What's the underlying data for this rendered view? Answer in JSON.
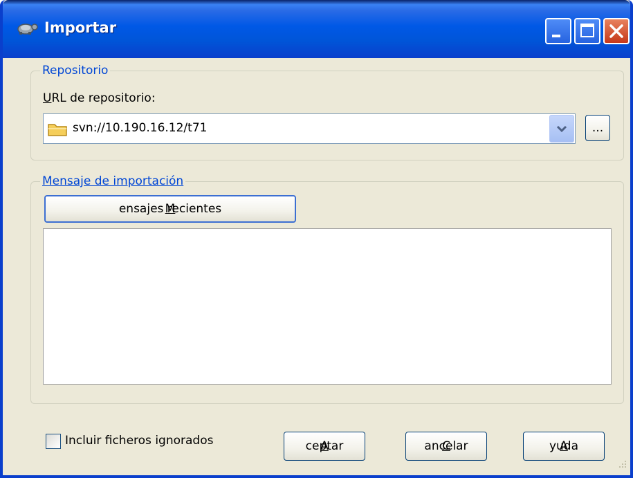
{
  "window": {
    "title": "Importar",
    "title_icon": "tortoise-icon",
    "controls": [
      "minimize-icon",
      "maximize-icon",
      "close-icon"
    ]
  },
  "repository": {
    "group_label": "Repositorio",
    "url_label_accel": "U",
    "url_label_rest": "RL de repositorio:",
    "url_value": "svn://10.190.16.12/t71",
    "browse_label": "..."
  },
  "message": {
    "group_label": "Mensaje de importación",
    "recent_accel": "M",
    "recent_rest": "ensajes recientes",
    "text": ""
  },
  "footer": {
    "include_ignored_label": "Incluir ficheros ignorados",
    "include_ignored_checked": false,
    "ok_accel": "A",
    "ok_rest": "ceptar",
    "cancel_accel": "C",
    "cancel_rest": "ancelar",
    "help_accel": "A",
    "help_rest": "yuda"
  },
  "colors": {
    "titlebar": "#0055D8",
    "dialog_bg": "#ECE9D8",
    "group_label": "#0046D5"
  }
}
